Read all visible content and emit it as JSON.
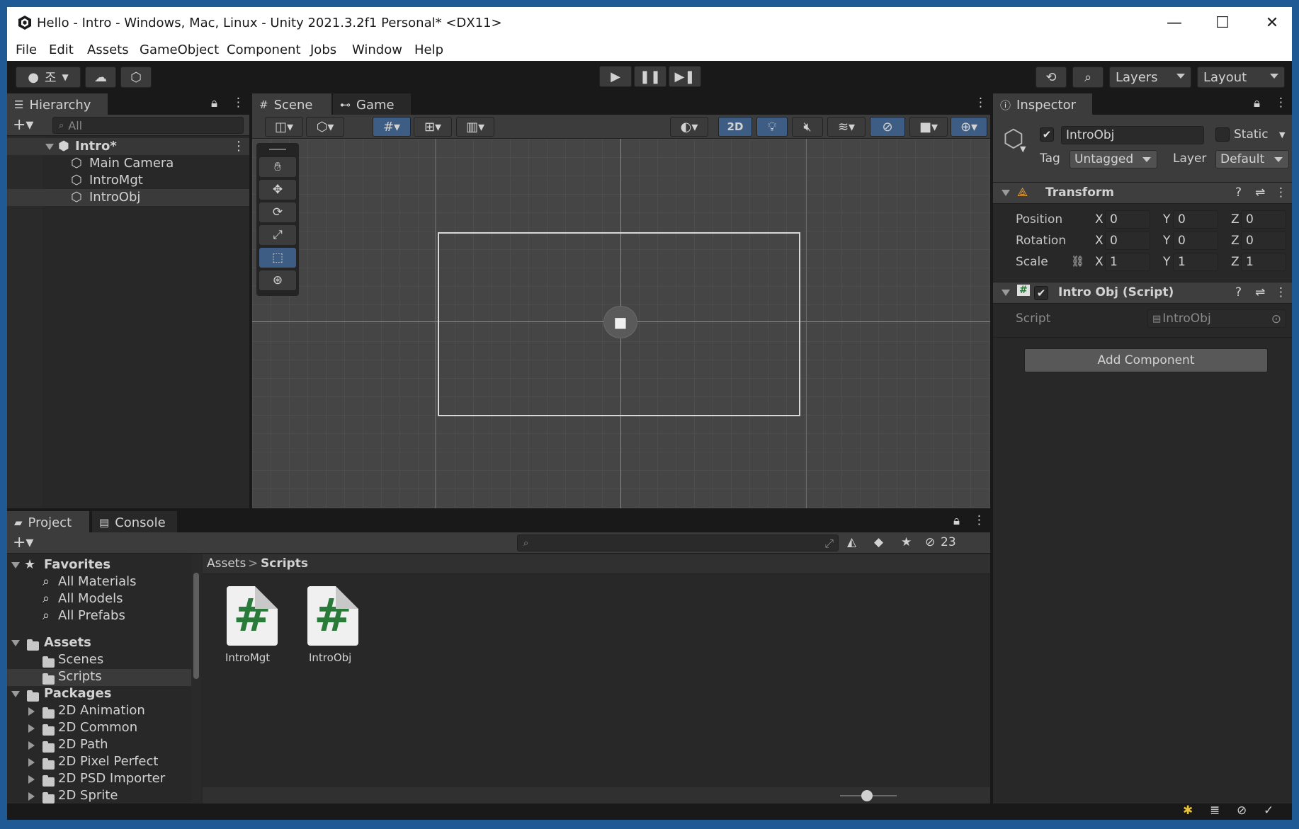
{
  "window": {
    "title": "Hello - Intro - Windows, Mac, Linux - Unity 2021.3.2f1 Personal* <DX11>",
    "minimize": "—",
    "maximize": "☐",
    "close": "✕"
  },
  "menu": [
    "File",
    "Edit",
    "Assets",
    "GameObject",
    "Component",
    "Jobs",
    "Window",
    "Help"
  ],
  "toolbar": {
    "account_letter": "조",
    "layers_label": "Layers",
    "layout_label": "Layout"
  },
  "hierarchy": {
    "tab_label": "Hierarchy",
    "search_placeholder": "All",
    "scene_name": "Intro*",
    "items": [
      "Main Camera",
      "IntroMgt",
      "IntroObj"
    ]
  },
  "scene": {
    "tab_scene": "Scene",
    "tab_game": "Game",
    "mode_2d": "2D"
  },
  "inspector": {
    "tab_label": "Inspector",
    "object_name": "IntroObj",
    "static_label": "Static",
    "tag_label": "Tag",
    "tag_value": "Untagged",
    "layer_label": "Layer",
    "layer_value": "Default",
    "transform_title": "Transform",
    "position_label": "Position",
    "rotation_label": "Rotation",
    "scale_label": "Scale",
    "axis_x": "X",
    "axis_y": "Y",
    "axis_z": "Z",
    "position": {
      "x": "0",
      "y": "0",
      "z": "0"
    },
    "rotation": {
      "x": "0",
      "y": "0",
      "z": "0"
    },
    "scale": {
      "x": "1",
      "y": "1",
      "z": "1"
    },
    "script_component_title": "Intro Obj (Script)",
    "script_label": "Script",
    "script_value": "IntroObj",
    "add_component": "Add Component"
  },
  "project": {
    "tab_project": "Project",
    "tab_console": "Console",
    "hidden_count": "23",
    "favorites_label": "Favorites",
    "favorites": [
      "All Materials",
      "All Models",
      "All Prefabs"
    ],
    "assets_label": "Assets",
    "asset_folders": [
      "Scenes",
      "Scripts"
    ],
    "packages_label": "Packages",
    "packages": [
      "2D Animation",
      "2D Common",
      "2D Path",
      "2D Pixel Perfect",
      "2D PSD Importer",
      "2D Sprite"
    ],
    "breadcrumb_root": "Assets",
    "breadcrumb_current": "Scripts",
    "breadcrumb_sep": ">",
    "files": [
      "IntroMgt",
      "IntroObj"
    ],
    "script_glyph": "#"
  },
  "colors": {
    "accent_blue": "#3d5d85",
    "selection": "#3a3a3a",
    "script_green": "#2a7a39"
  }
}
